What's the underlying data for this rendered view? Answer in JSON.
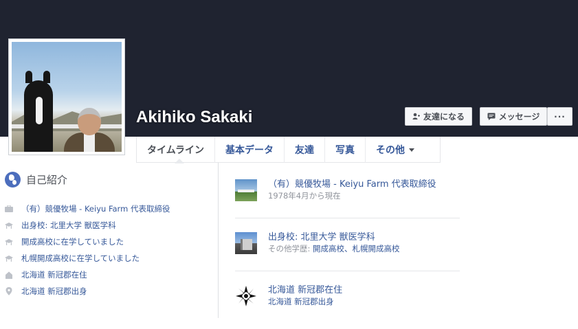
{
  "profile": {
    "name": "Akihiko Sakaki",
    "photo_description": "profile photo"
  },
  "actions": {
    "add_friend": "友達になる",
    "message": "メッセージ",
    "more": "···"
  },
  "tabs": [
    {
      "label": "タイムライン",
      "active": true
    },
    {
      "label": "基本データ",
      "active": false
    },
    {
      "label": "友達",
      "active": false
    },
    {
      "label": "写真",
      "active": false
    },
    {
      "label": "その他",
      "active": false,
      "dropdown": true
    }
  ],
  "intro": {
    "title": "自己紹介",
    "items": [
      {
        "icon": "briefcase-icon",
        "text": "（有）競優牧場 - Keiyu Farm 代表取締役"
      },
      {
        "icon": "graduation-cap-icon",
        "text": "出身校: 北里大学 獣医学科"
      },
      {
        "icon": "graduation-cap-icon",
        "text": "開成高校に在学していました"
      },
      {
        "icon": "graduation-cap-icon",
        "text": "札幌開成高校に在学していました"
      },
      {
        "icon": "house-icon",
        "text": "北海道 新冠郡在住"
      },
      {
        "icon": "map-pin-icon",
        "text": "北海道 新冠郡出身"
      }
    ]
  },
  "about": {
    "work": {
      "title": "（有）競優牧場 - Keiyu Farm 代表取締役",
      "sub": "1978年4月から現在"
    },
    "education": {
      "title": "出身校: 北里大学 獣医学科",
      "sub_prefix": "その他学歴: ",
      "sub_links": "開成高校、札幌開成高校"
    },
    "places": {
      "title": "北海道 新冠郡在住",
      "sub": "北海道 新冠郡出身"
    }
  },
  "colors": {
    "cover": "#1f2330",
    "link": "#365899",
    "muted": "#90949c"
  }
}
